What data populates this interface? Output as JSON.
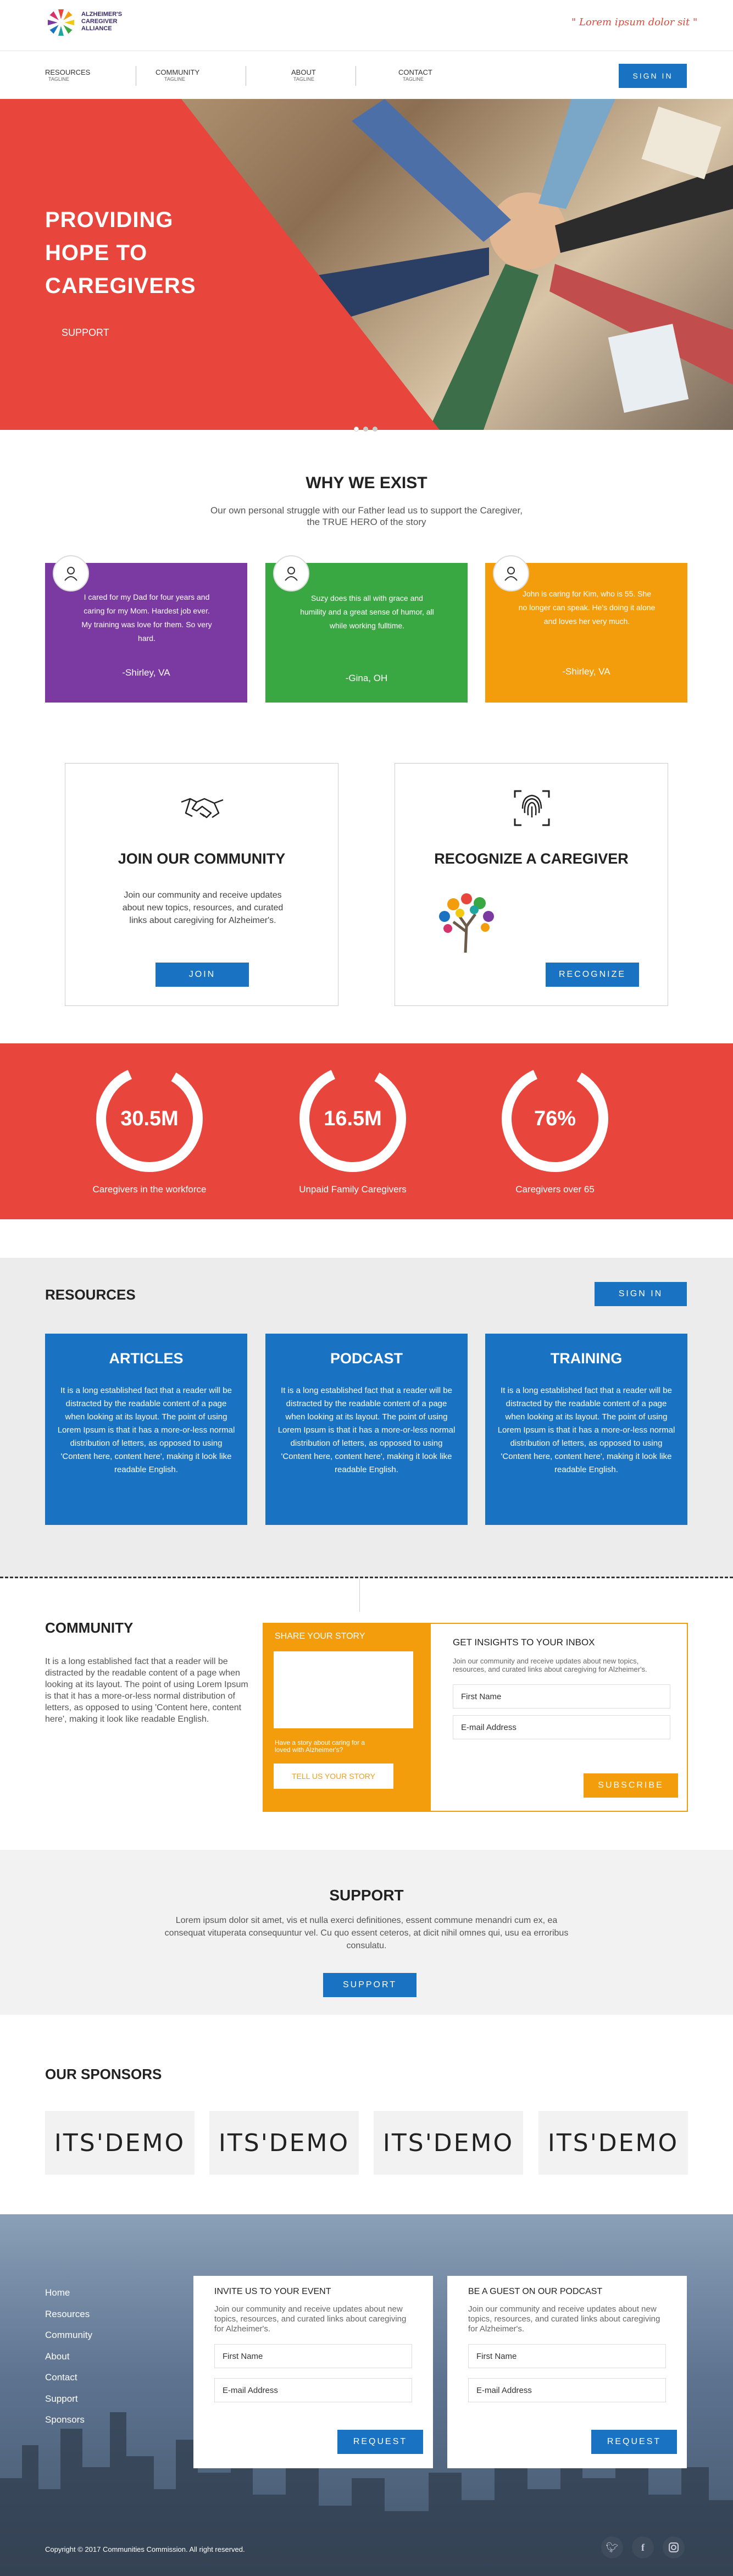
{
  "header": {
    "logo_text": "ALZHEIMER'S CAREGIVER ALLIANCE",
    "tagline": "\" Lorem ipsum dolor sit \"",
    "nav": [
      {
        "label": "RESOURCES",
        "sub": "TAGLINE"
      },
      {
        "label": "COMMUNITY",
        "sub": "TAGLINE"
      },
      {
        "label": "ABOUT",
        "sub": "TAGLINE"
      },
      {
        "label": "CONTACT",
        "sub": "TAGLINE"
      }
    ],
    "sign_in": "SIGN IN"
  },
  "hero": {
    "title": "PROVIDING HOPE TO CAREGIVERS",
    "support_link": "SUPPORT",
    "slides": 3,
    "active_slide": 1
  },
  "why": {
    "title": "WHY WE EXIST",
    "subtitle": "Our own personal struggle with our Father lead us to support the Caregiver, the TRUE HERO of the story",
    "testimonials": [
      {
        "text": "I cared for my Dad for four years and caring for my Mom. Hardest job ever. My training was love for them. So very hard.",
        "author": "-Shirley, VA",
        "color": "#7b3aa2"
      },
      {
        "text": "Suzy does this all with grace and humility and a great sense of humor, all while working fulltime.",
        "author": "-Gina, OH",
        "color": "#3aa842"
      },
      {
        "text": "John is caring for Kim, who is 55. She no longer can speak. He's doing it alone and loves her very much.",
        "author": "-Shirley, VA",
        "color": "#f49d0c"
      }
    ]
  },
  "join": {
    "title": "JOIN OUR COMMUNITY",
    "text": "Join our community and receive updates about new topics, resources, and curated links about caregiving for Alzheimer's.",
    "button": "JOIN"
  },
  "recognize": {
    "title": "RECOGNIZE A CAREGIVER",
    "button": "RECOGNIZE"
  },
  "stats": [
    {
      "value": "30.5M",
      "label": "Caregivers in the workforce",
      "fraction": 0.85
    },
    {
      "value": "16.5M",
      "label": "Unpaid Family Caregivers",
      "fraction": 0.85
    },
    {
      "value": "76%",
      "label": "Caregivers over 65",
      "fraction": 0.85
    }
  ],
  "resources": {
    "title": "RESOURCES",
    "sign_in": "SIGN IN",
    "cards": [
      {
        "title": "ARTICLES",
        "text": "It is a long established fact that a reader will be distracted by the readable content of a page when looking at its layout. The point of using Lorem Ipsum is that it has a more-or-less normal distribution of letters, as opposed to using 'Content here, content here', making it look like readable English."
      },
      {
        "title": "PODCAST",
        "text": "It is a long established fact that a reader will be distracted by the readable content of a page when looking at its layout. The point of using Lorem Ipsum is that it has a more-or-less normal distribution of letters, as opposed to using 'Content here, content here', making it look like readable English."
      },
      {
        "title": "TRAINING",
        "text": "It is a long established fact that a reader will be distracted by the readable content of a page when looking at its layout. The point of using Lorem Ipsum is that it has a more-or-less normal distribution of letters, as opposed to using 'Content here, content here', making it look like readable English."
      }
    ]
  },
  "community": {
    "title": "COMMUNITY",
    "text": "It is a long established fact that a reader will be distracted by the readable content of a page when looking at its layout. The point of using Lorem Ipsum is that it has a more-or-less normal distribution of letters, as opposed to using 'Content here, content here', making it look like readable English.",
    "story_title": "SHARE YOUR STORY",
    "story_prompt": "Have a story about caring for a loved with Alzheimer's?",
    "story_button": "TELL US YOUR STORY",
    "inbox_title": "GET INSIGHTS TO YOUR INBOX",
    "inbox_text": "Join our community and receive updates about new topics, resources, and curated links about caregiving for Alzheimer's.",
    "first_name": "First Name",
    "email": "E-mail Address",
    "subscribe": "SUBSCRIBE"
  },
  "support": {
    "title": "SUPPORT",
    "text": "Lorem ipsum dolor sit amet, vis et nulla exerci definitiones, essent commune menandri cum ex, ea consequat vituperata consequuntur vel. Cu quo essent ceteros, at dicit nihil omnes qui, usu ea erroribus consulatu.",
    "button": "SUPPORT"
  },
  "sponsors": {
    "title": "OUR SPONSORS",
    "logos": [
      "ITS'DEMO",
      "ITS'DEMO",
      "ITS'DEMO",
      "ITS'DEMO"
    ]
  },
  "footer": {
    "links": [
      "Home",
      "Resources",
      "Community",
      "About",
      "Contact",
      "Support",
      "Sponsors"
    ],
    "event": {
      "title": "INVITE US TO YOUR EVENT",
      "text": "Join our community and receive updates about new topics, resources, and curated links about caregiving for Alzheimer's.",
      "first_name": "First Name",
      "email": "E-mail Address",
      "button": "REQUEST"
    },
    "podcast": {
      "title": "BE A GUEST ON OUR PODCAST",
      "text": "Join our community and receive updates about new topics, resources, and curated links about caregiving for Alzheimer's.",
      "first_name": "First Name",
      "email": "E-mail Address",
      "button": "REQUEST"
    },
    "copyright": "Copyright © 2017 Communities Commission. All right reserved.",
    "social": [
      "twitter-icon",
      "facebook-icon",
      "instagram-icon"
    ]
  }
}
